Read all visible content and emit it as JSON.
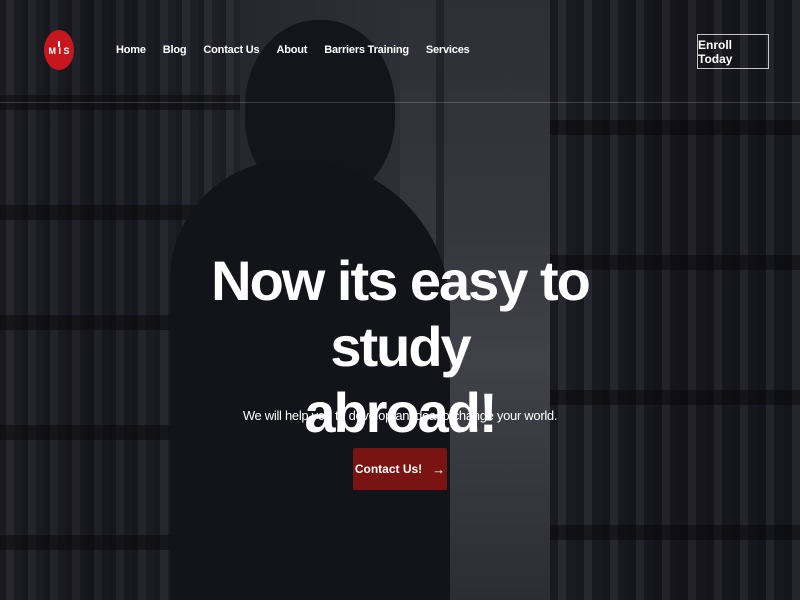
{
  "brand": {
    "logo_text": "MIS",
    "logo_color": "#c8161f"
  },
  "nav": {
    "items": [
      {
        "label": "Home"
      },
      {
        "label": "Blog"
      },
      {
        "label": "Contact Us"
      },
      {
        "label": "About"
      },
      {
        "label": "Barriers Training"
      },
      {
        "label": "Services"
      }
    ],
    "enroll_label": "Enroll Today"
  },
  "hero": {
    "headline_line1": "Now its easy to study",
    "headline_line2": "abroad!",
    "subtitle": "We will help you to develop an idea to change your world.",
    "cta_label": "Contact Us!",
    "cta_icon": "arrow-right-icon",
    "cta_color": "#7a1412"
  }
}
